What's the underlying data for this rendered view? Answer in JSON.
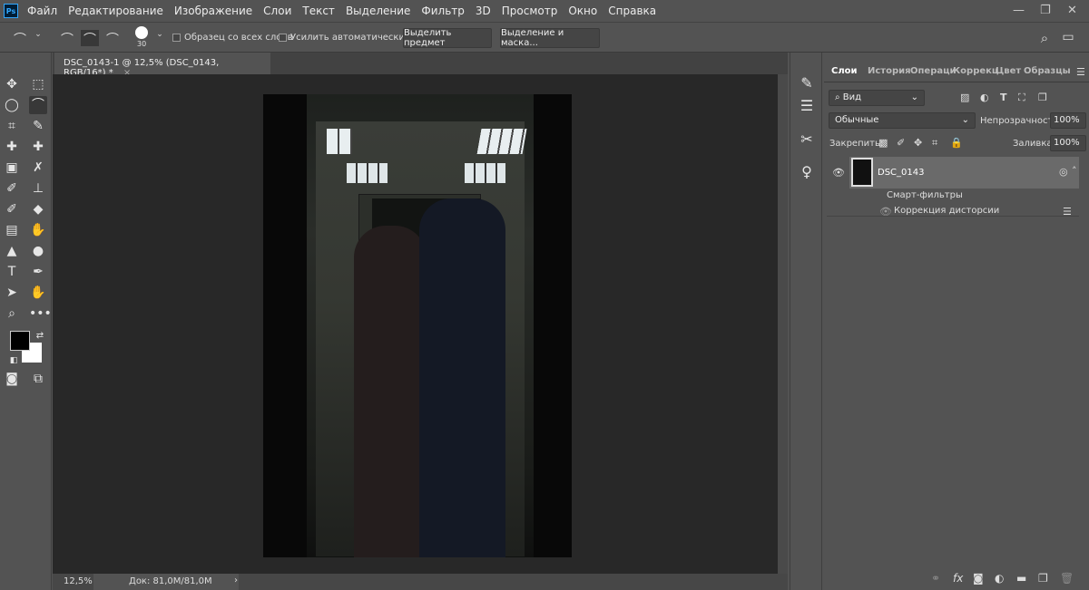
{
  "menubar": {
    "logo": "Ps",
    "items": [
      "Файл",
      "Редактирование",
      "Изображение",
      "Слои",
      "Текст",
      "Выделение",
      "Фильтр",
      "3D",
      "Просмотр",
      "Окно",
      "Справка"
    ]
  },
  "options": {
    "brush_size": "30",
    "sample_all_layers": "Образец со всех слоев",
    "auto_enhance": "Усилить автоматически",
    "select_subject": "Выделить предмет",
    "select_and_mask": "Выделение и маска..."
  },
  "document": {
    "tab_title": "DSC_0143-1 @ 12,5% (DSC_0143, RGB/16*) *",
    "close": "×"
  },
  "status": {
    "zoom": "12,5%",
    "doc": "Док: 81,0M/81,0M",
    "arrow": "›"
  },
  "panel": {
    "tabs": [
      "Слои",
      "История",
      "Операци",
      "Коррекц",
      "Цвет",
      "Образцы"
    ],
    "filter_kind": "Вид",
    "blend_mode": "Обычные",
    "opacity_label": "Непрозрачность:",
    "opacity": "100%",
    "lock_label": "Закрепить:",
    "fill_label": "Заливка:",
    "fill": "100%",
    "layers": [
      {
        "name": "DSC_0143",
        "visible": true,
        "smart_filters_label": "Смарт-фильтры",
        "filters": [
          "Коррекция дисторсии"
        ]
      }
    ]
  },
  "colors": {
    "foreground": "#000000",
    "background": "#ffffff",
    "accent": "#31a8ff"
  }
}
